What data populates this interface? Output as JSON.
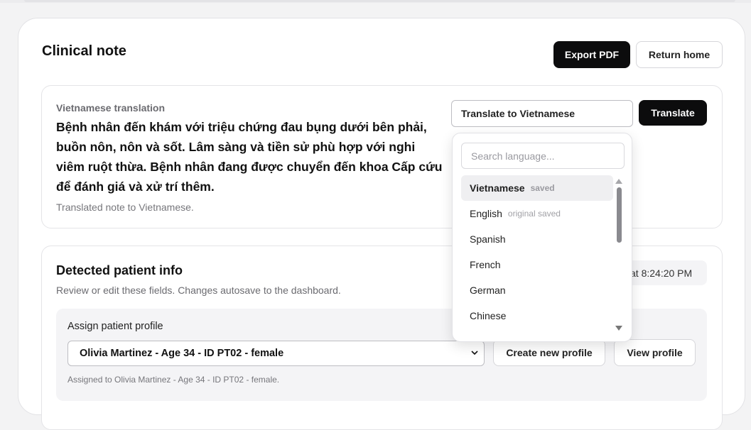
{
  "page": {
    "title": "Clinical note",
    "export_pdf_label": "Export PDF",
    "return_home_label": "Return home"
  },
  "translation": {
    "label": "Vietnamese translation",
    "text": "Bệnh nhân đến khám với triệu chứng đau bụng dưới bên phải, buồn nôn, nôn và sốt. Lâm sàng và tiền sử phù hợp với nghi viêm ruột thừa. Bệnh nhân đang được chuyển đến khoa Cấp cứu để đánh giá và xử trí thêm.",
    "status": "Translated note to Vietnamese.",
    "selector_value": "Translate to Vietnamese",
    "translate_label": "Translate"
  },
  "language_dropdown": {
    "search_placeholder": "Search language...",
    "options": [
      {
        "label": "Vietnamese",
        "tag": "saved",
        "active": true
      },
      {
        "label": "English",
        "tag": "original saved"
      },
      {
        "label": "Spanish",
        "tag": ""
      },
      {
        "label": "French",
        "tag": ""
      },
      {
        "label": "German",
        "tag": ""
      },
      {
        "label": "Chinese",
        "tag": ""
      }
    ]
  },
  "patient_info": {
    "title": "Detected patient info",
    "description": "Review or edit these fields. Changes autosave to the dashboard.",
    "autosave_text": "at 8:24:20 PM",
    "assign_label": "Assign patient profile",
    "selected_profile": "Olivia Martinez - Age 34 - ID PT02 - female",
    "create_profile_label": "Create new profile",
    "view_profile_label": "View profile",
    "assigned_note": "Assigned to Olivia Martinez - Age 34 - ID PT02 - female."
  }
}
